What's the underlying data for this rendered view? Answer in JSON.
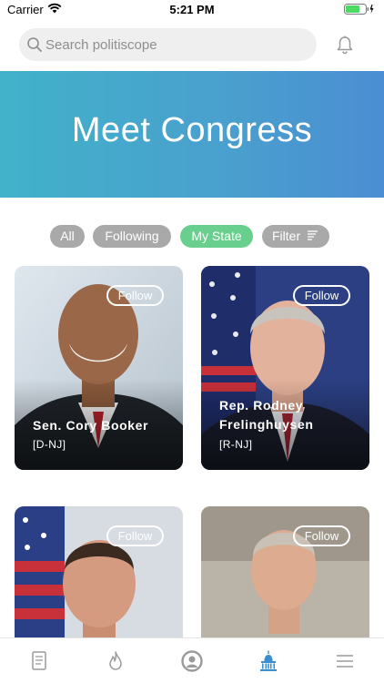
{
  "status_bar": {
    "carrier": "Carrier",
    "time": "5:21 PM"
  },
  "search": {
    "placeholder": "Search politiscope",
    "icon": "search-icon"
  },
  "header": {
    "notification_icon": "bell-icon"
  },
  "hero": {
    "title": "Meet Congress"
  },
  "filters": {
    "all": "All",
    "following": "Following",
    "my_state": "My State",
    "filter": "Filter",
    "active": "My State"
  },
  "cards": [
    {
      "name": "Sen. Cory Booker",
      "party": "[D-NJ]",
      "follow_label": "Follow"
    },
    {
      "name": "Rep. Rodney Frelinghuysen",
      "party": "[R-NJ]",
      "follow_label": "Follow"
    },
    {
      "name": "",
      "party": "",
      "follow_label": "Follow"
    },
    {
      "name": "",
      "party": "",
      "follow_label": "Follow"
    }
  ],
  "tab_bar": {
    "items": [
      {
        "icon": "document-icon"
      },
      {
        "icon": "flame-icon"
      },
      {
        "icon": "badge-icon"
      },
      {
        "icon": "capitol-icon",
        "active": true
      },
      {
        "icon": "menu-icon"
      }
    ],
    "active_color": "#3a8fd0",
    "inactive_color": "#9a9a9a"
  },
  "colors": {
    "hero_start": "#41b2c9",
    "hero_end": "#4b8ed3",
    "chip_active": "#69cf8e",
    "chip_inactive": "#a9a9a9"
  }
}
